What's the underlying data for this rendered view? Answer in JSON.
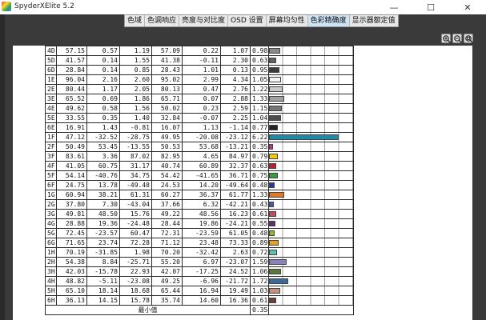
{
  "window": {
    "title": "SpyderXElite 5.2",
    "min_glyph": "—",
    "max_glyph": "☐",
    "close_glyph": "✕"
  },
  "tabs": [
    {
      "label": "色域",
      "active": false
    },
    {
      "label": "色调响应",
      "active": false
    },
    {
      "label": "亮度与对比度",
      "active": false
    },
    {
      "label": "OSD 设置",
      "active": false
    },
    {
      "label": "屏幕均匀性",
      "active": false
    },
    {
      "label": "色彩精确度",
      "active": true
    },
    {
      "label": "显示器额定值",
      "active": false
    }
  ],
  "zoom": {
    "icons": [
      "zoom-in-icon",
      "zoom-out-icon",
      "zoom-fit-icon"
    ]
  },
  "table": {
    "rows": [
      {
        "id": "4D",
        "c1": "57.15",
        "c2": "0.57",
        "c3": "1.19",
        "c4": "57.09",
        "c5": "0.22",
        "c6": "1.07",
        "de": "0.98",
        "color": "#8a8a8a"
      },
      {
        "id": "5D",
        "c1": "41.57",
        "c2": "0.14",
        "c3": "1.55",
        "c4": "41.38",
        "c5": "-0.11",
        "c6": "2.30",
        "de": "0.63",
        "color": "#5f5f5f"
      },
      {
        "id": "6D",
        "c1": "28.84",
        "c2": "0.14",
        "c3": "0.85",
        "c4": "28.43",
        "c5": "1.01",
        "c6": "0.13",
        "de": "0.95",
        "color": "#3b3b3b"
      },
      {
        "id": "1E",
        "c1": "96.04",
        "c2": "2.16",
        "c3": "2.60",
        "c4": "95.02",
        "c5": "2.99",
        "c6": "4.34",
        "de": "1.05",
        "color": "#f4f4f4"
      },
      {
        "id": "2E",
        "c1": "80.44",
        "c2": "1.17",
        "c3": "2.05",
        "c4": "80.13",
        "c5": "0.47",
        "c6": "2.76",
        "de": "1.22",
        "color": "#cbcbcb"
      },
      {
        "id": "3E",
        "c1": "65.52",
        "c2": "0.69",
        "c3": "1.86",
        "c4": "65.71",
        "c5": "0.07",
        "c6": "2.88",
        "de": "1.33",
        "color": "#a2a2a2"
      },
      {
        "id": "4E",
        "c1": "49.62",
        "c2": "0.58",
        "c3": "1.56",
        "c4": "50.02",
        "c5": "0.23",
        "c6": "2.59",
        "de": "1.15",
        "color": "#777777"
      },
      {
        "id": "5E",
        "c1": "33.55",
        "c2": "0.35",
        "c3": "1.40",
        "c4": "32.84",
        "c5": "-0.07",
        "c6": "2.25",
        "de": "1.04",
        "color": "#4d4d4d"
      },
      {
        "id": "6E",
        "c1": "16.91",
        "c2": "1.43",
        "c3": "-0.81",
        "c4": "16.07",
        "c5": "1.13",
        "c6": "-1.14",
        "de": "0.77",
        "color": "#222222"
      },
      {
        "id": "1F",
        "c1": "47.12",
        "c2": "-32.52",
        "c3": "-28.75",
        "c4": "49.95",
        "c5": "-20.08",
        "c6": "-23.12",
        "de": "6.22",
        "color": "#1f8aa8"
      },
      {
        "id": "2F",
        "c1": "50.49",
        "c2": "53.45",
        "c3": "-13.55",
        "c4": "50.53",
        "c5": "53.68",
        "c6": "-13.21",
        "de": "0.35",
        "color": "#c4368a"
      },
      {
        "id": "3F",
        "c1": "83.61",
        "c2": "3.36",
        "c3": "87.02",
        "c4": "82.95",
        "c5": "4.65",
        "c6": "84.97",
        "de": "0.79",
        "color": "#f0c810"
      },
      {
        "id": "4F",
        "c1": "41.05",
        "c2": "60.75",
        "c3": "31.17",
        "c4": "40.74",
        "c5": "60.89",
        "c6": "32.37",
        "de": "0.63",
        "color": "#c41a3a"
      },
      {
        "id": "5F",
        "c1": "54.14",
        "c2": "-40.76",
        "c3": "34.75",
        "c4": "54.42",
        "c5": "-41.65",
        "c6": "36.71",
        "de": "0.75",
        "color": "#3a9b3e"
      },
      {
        "id": "6F",
        "c1": "24.75",
        "c2": "13.78",
        "c3": "-49.48",
        "c4": "24.53",
        "c5": "14.20",
        "c6": "-49.64",
        "de": "0.48",
        "color": "#2a3a9a"
      },
      {
        "id": "1G",
        "c1": "60.94",
        "c2": "38.21",
        "c3": "61.31",
        "c4": "60.27",
        "c5": "36.37",
        "c6": "61.77",
        "de": "1.33",
        "color": "#e07a22"
      },
      {
        "id": "2G",
        "c1": "37.80",
        "c2": "7.30",
        "c3": "-43.04",
        "c4": "37.66",
        "c5": "6.32",
        "c6": "-42.21",
        "de": "0.43",
        "color": "#4a5aa8"
      },
      {
        "id": "3G",
        "c1": "49.81",
        "c2": "48.50",
        "c3": "15.76",
        "c4": "49.22",
        "c5": "48.56",
        "c6": "16.23",
        "de": "0.61",
        "color": "#c44a62"
      },
      {
        "id": "4G",
        "c1": "28.88",
        "c2": "19.36",
        "c3": "-24.48",
        "c4": "28.44",
        "c5": "19.86",
        "c6": "-24.21",
        "de": "0.55",
        "color": "#5a2e6a"
      },
      {
        "id": "5G",
        "c1": "72.45",
        "c2": "-23.57",
        "c3": "60.47",
        "c4": "72.31",
        "c5": "-23.59",
        "c6": "61.05",
        "de": "0.48",
        "color": "#8ab830"
      },
      {
        "id": "6G",
        "c1": "71.65",
        "c2": "23.74",
        "c3": "72.28",
        "c4": "71.12",
        "c5": "23.48",
        "c6": "73.33",
        "de": "0.89",
        "color": "#e8a022"
      },
      {
        "id": "1H",
        "c1": "70.19",
        "c2": "-31.85",
        "c3": "1.98",
        "c4": "70.20",
        "c5": "-32.42",
        "c6": "2.63",
        "de": "0.72",
        "color": "#5ec0b0"
      },
      {
        "id": "2H",
        "c1": "54.38",
        "c2": "8.84",
        "c3": "-25.71",
        "c4": "55.20",
        "c5": "6.97",
        "c6": "-23.07",
        "de": "1.59",
        "color": "#8a82c0"
      },
      {
        "id": "3H",
        "c1": "42.03",
        "c2": "-15.78",
        "c3": "22.93",
        "c4": "42.07",
        "c5": "-17.25",
        "c6": "24.52",
        "de": "1.06",
        "color": "#5a7a3a"
      },
      {
        "id": "4H",
        "c1": "48.82",
        "c2": "-5.11",
        "c3": "-23.08",
        "c4": "49.25",
        "c5": "-6.96",
        "c6": "-21.72",
        "de": "1.72",
        "color": "#3a6a9a"
      },
      {
        "id": "5H",
        "c1": "65.10",
        "c2": "18.14",
        "c3": "18.68",
        "c4": "65.44",
        "c5": "16.94",
        "c6": "19.49",
        "de": "1.03",
        "color": "#c89078"
      },
      {
        "id": "6H",
        "c1": "36.13",
        "c2": "14.15",
        "c3": "15.78",
        "c4": "35.74",
        "c5": "14.60",
        "c6": "16.36",
        "de": "0.61",
        "color": "#6a4030"
      }
    ],
    "footer": {
      "label": "最小值",
      "value": "0.35"
    }
  }
}
